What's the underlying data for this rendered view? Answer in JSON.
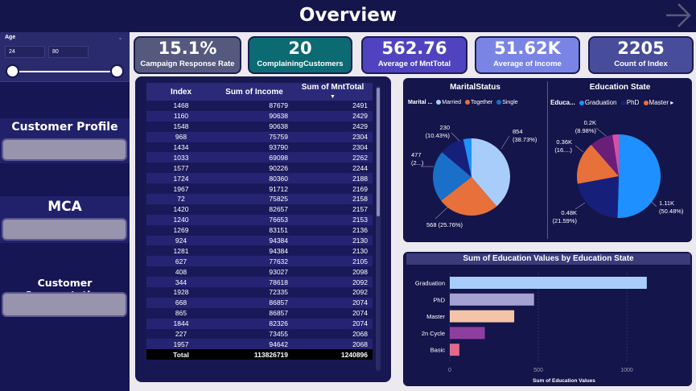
{
  "header": {
    "title": "Overview"
  },
  "sidebar": {
    "age": {
      "label": "Age",
      "min": "24",
      "max": "80"
    },
    "nav": [
      {
        "label": "Customer Profile"
      },
      {
        "label": "MCA"
      },
      {
        "label": "Customer Segmentation"
      }
    ]
  },
  "kpis": [
    {
      "value": "15.1%",
      "label": "Campaign Response Rate",
      "color": "#55597e"
    },
    {
      "value": "20",
      "label": "ComplainingCustomers",
      "color": "#0c6a72"
    },
    {
      "value": "562.76",
      "label": "Average of MntTotal",
      "color": "#4f43bf"
    },
    {
      "value": "51.62K",
      "label": "Average of Income",
      "color": "#7a84e4"
    },
    {
      "value": "2205",
      "label": "Count of Index",
      "color": "#474d9a"
    }
  ],
  "table": {
    "headers": [
      "Index",
      "Sum of Income",
      "Sum of MntTotal"
    ],
    "rows": [
      [
        "1468",
        "87679",
        "2491"
      ],
      [
        "1160",
        "90638",
        "2429"
      ],
      [
        "1548",
        "90638",
        "2429"
      ],
      [
        "968",
        "75759",
        "2304"
      ],
      [
        "1434",
        "93790",
        "2304"
      ],
      [
        "1033",
        "69098",
        "2262"
      ],
      [
        "1577",
        "90226",
        "2244"
      ],
      [
        "1724",
        "80360",
        "2188"
      ],
      [
        "1967",
        "91712",
        "2169"
      ],
      [
        "72",
        "75825",
        "2158"
      ],
      [
        "1420",
        "82657",
        "2157"
      ],
      [
        "1240",
        "76653",
        "2153"
      ],
      [
        "1269",
        "83151",
        "2136"
      ],
      [
        "924",
        "94384",
        "2130"
      ],
      [
        "1281",
        "94384",
        "2130"
      ],
      [
        "627",
        "77632",
        "2105"
      ],
      [
        "408",
        "93027",
        "2098"
      ],
      [
        "344",
        "78618",
        "2092"
      ],
      [
        "1928",
        "72335",
        "2092"
      ],
      [
        "668",
        "86857",
        "2074"
      ],
      [
        "865",
        "86857",
        "2074"
      ],
      [
        "1844",
        "82326",
        "2074"
      ],
      [
        "227",
        "73455",
        "2068"
      ],
      [
        "1957",
        "94642",
        "2068"
      ]
    ],
    "total": [
      "Total",
      "113826719",
      "1240896"
    ]
  },
  "marital": {
    "title": "MaritalStatus",
    "legend_title": "Marital ...",
    "slices": [
      {
        "name": "Married",
        "value": 854,
        "label1": "854",
        "label2": "(38.73%)",
        "color": "#a8cdfb"
      },
      {
        "name": "Together",
        "value": 568,
        "label1": "568 (25.76%)",
        "label2": "",
        "color": "#e8703a"
      },
      {
        "name": "Single",
        "value": 477,
        "label1": "477",
        "label2": "(2...)",
        "color": "#1a6fc8"
      },
      {
        "name": "",
        "value": 230,
        "label1": "230",
        "label2": "(10.43%)",
        "color": "#16207a"
      },
      {
        "name": "",
        "value": 76,
        "label1": "",
        "label2": "",
        "color": "#1e90ff"
      }
    ]
  },
  "education": {
    "title": "Education State",
    "legend_title": "Educa...",
    "slices": [
      {
        "name": "Graduation",
        "value": 1113,
        "label1": "1.11K",
        "label2": "(50.48%)",
        "color": "#1e90ff"
      },
      {
        "name": "PhD",
        "value": 476,
        "label1": "0.48K",
        "label2": "(21.59%)",
        "color": "#16207a"
      },
      {
        "name": "Master",
        "value": 364,
        "label1": "0.36K",
        "label2": "(16....)",
        "color": "#e8703a"
      },
      {
        "name": "",
        "value": 198,
        "label1": "0.2K",
        "label2": "(8.98%)",
        "color": "#6b1d7a"
      },
      {
        "name": "",
        "value": 54,
        "label1": "",
        "label2": "",
        "color": "#d74fa6"
      }
    ]
  },
  "chart_data": {
    "type": "bar",
    "title": "Sum of Education Values by Education State",
    "xlabel": "Sum of Education Values",
    "ylabel": "",
    "categories": [
      "Graduation",
      "PhD",
      "Master",
      "2n Cycle",
      "Basic"
    ],
    "values": [
      1113,
      476,
      364,
      198,
      54
    ],
    "colors": [
      "#a8cdfb",
      "#a4a2d2",
      "#f5c4a8",
      "#8e3e9e",
      "#e06a8c"
    ],
    "xlim": [
      0,
      1200
    ],
    "xticks": [
      "0",
      "500",
      "1000"
    ]
  }
}
